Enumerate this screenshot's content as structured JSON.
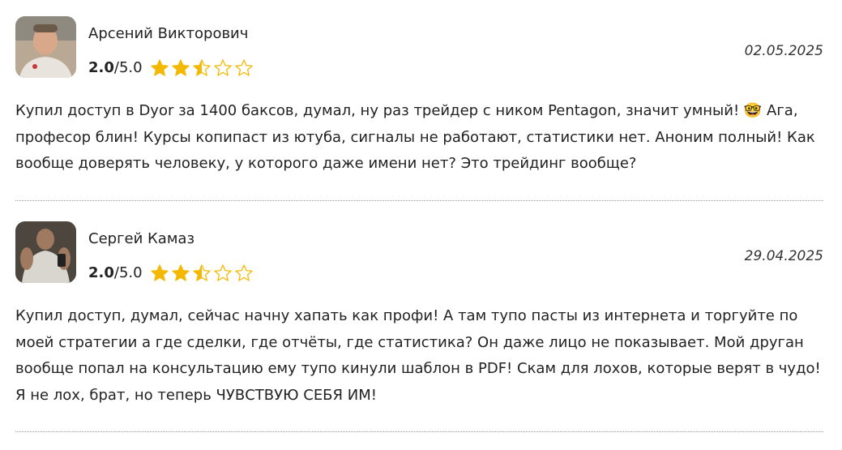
{
  "reviews": [
    {
      "author": "Арсений Викторович",
      "score": "2.0",
      "max": "/5.0",
      "rating_value": 2.5,
      "date": "02.05.2025",
      "text": "Купил доступ в Dyor за 1400 баксов, думал, ну раз трейдер с ником Pentagon, значит умный! 🤓 Ага, професор блин! Курсы копипаст из ютуба, сигналы не работают, статистики нет. Аноним полный! Как вообще доверять человеку, у которого даже имени нет? Это трейдинг вообще?"
    },
    {
      "author": "Сергей Камаз",
      "score": "2.0",
      "max": "/5.0",
      "rating_value": 2.5,
      "date": "29.04.2025",
      "text": "Купил доступ, думал, сейчас начну хапать как профи! А там тупо пасты из интернета и торгуйте по моей стратегии а где сделки, где отчёты, где статистика? Он даже лицо не показывает. Мой друган вообще попал на консультацию ему тупо кинули шаблон в PDF! Скам для лохов, которые верят в чудо! Я не лох, брат, но теперь ЧУВСТВУЮ СЕБЯ ИМ!"
    }
  ],
  "colors": {
    "star_fill": "#f5b800",
    "divider": "#9a9a9a"
  },
  "icons": {
    "full": "star-filled-icon",
    "half": "star-half-icon",
    "empty": "star-empty-icon"
  }
}
